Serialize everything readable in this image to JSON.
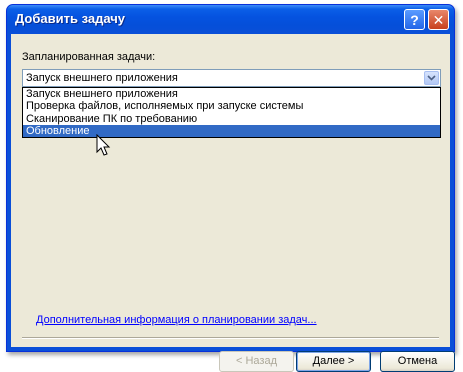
{
  "window": {
    "title": "Добавить задачу",
    "help_label": "?",
    "close_label": "✕"
  },
  "form": {
    "label": "Запланированная задачи:",
    "combo_value": "Запуск внешнего приложения",
    "combo_arrow": "⌄",
    "options": [
      {
        "label": "Запуск внешнего приложения",
        "selected": false
      },
      {
        "label": "Проверка файлов, исполняемых при запуске системы",
        "selected": false
      },
      {
        "label": "Сканирование ПК по требованию",
        "selected": false
      },
      {
        "label": "Обновление",
        "selected": true
      }
    ]
  },
  "link": {
    "label": "Дополнительная информация о планировании задач..."
  },
  "buttons": {
    "back": "< Назад",
    "next": "Далее >",
    "cancel": "Отмена"
  },
  "colors": {
    "selection": "#316ac5",
    "titlebar": "#0a4fd8",
    "client": "#ece9d8",
    "link": "#0000ff"
  },
  "cursor": "arrow-cursor"
}
